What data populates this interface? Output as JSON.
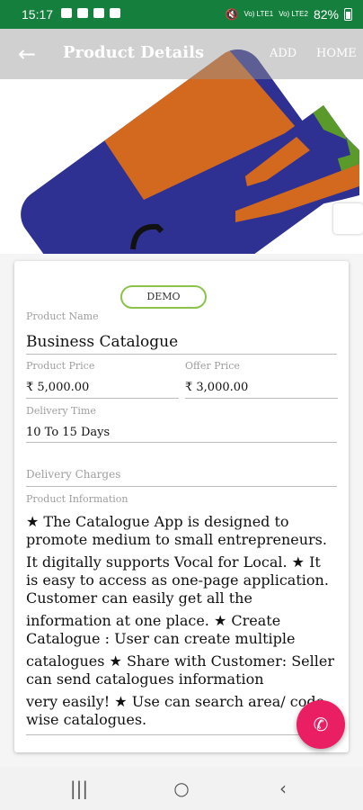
{
  "status_bar": {
    "time": "15:17",
    "network_1": "Vo) LTE1",
    "network_2": "Vo) LTE2",
    "battery": "82%"
  },
  "app_bar": {
    "title": "Product Details",
    "actions": [
      "ADD",
      "HOME"
    ]
  },
  "product": {
    "badge": "DEMO",
    "name_label": "Product Name",
    "name": "Business Catalogue",
    "price_label": "Product Price",
    "price": "₹ 5,000.00",
    "offer_label": "Offer Price",
    "offer": "₹ 3,000.00",
    "delivery_time_label": "Delivery Time",
    "delivery_time": "10 To 15 Days",
    "delivery_charges_label": "Delivery Charges",
    "info_label": "Product Information",
    "info_lines": [
      "★ The Catalogue App is designed to promote medium to small entrepreneurs.",
      "It digitally supports Vocal for Local.  ★ It is easy to access as one-page application. Customer can easily get all the",
      "information at one place.  ★ Create Catalogue : User can create multiple",
      "catalogues  ★ Share with Customer: Seller can send catalogues information",
      "very easily!  ★ Use can search area/ code wise catalogues."
    ]
  },
  "colors": {
    "status_bar": "#15803d",
    "stripe_blue": "#2e3192",
    "stripe_orange": "#d2691e",
    "stripe_green": "#5a9a2a",
    "fab": "#e91e63"
  },
  "icons": {
    "back": "arrow-left",
    "fab": "whatsapp",
    "nav": [
      "recents",
      "home",
      "back"
    ]
  }
}
